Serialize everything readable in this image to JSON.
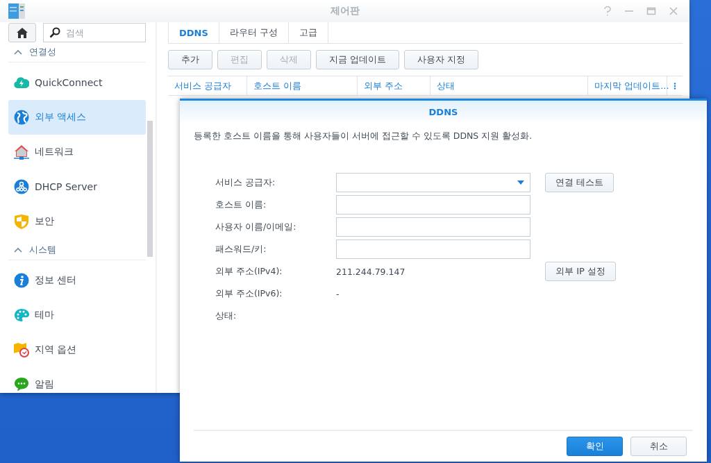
{
  "window": {
    "title": "제어판"
  },
  "search": {
    "placeholder": "검색"
  },
  "sidebar": {
    "sections": [
      {
        "title": "연결성",
        "expanded": true,
        "items": [
          {
            "label": "QuickConnect",
            "kind": "cloud",
            "selected": false
          },
          {
            "label": "외부 액세스",
            "kind": "globe",
            "selected": true
          },
          {
            "label": "네트워크",
            "kind": "house",
            "selected": false
          },
          {
            "label": "DHCP Server",
            "kind": "nodes",
            "selected": false
          },
          {
            "label": "보안",
            "kind": "shield",
            "selected": false
          }
        ]
      },
      {
        "title": "시스템",
        "expanded": true,
        "items": [
          {
            "label": "정보 센터",
            "kind": "info",
            "selected": false
          },
          {
            "label": "테마",
            "kind": "palette",
            "selected": false
          },
          {
            "label": "지역 옵션",
            "kind": "map",
            "selected": false
          },
          {
            "label": "알림",
            "kind": "chat",
            "selected": false
          }
        ]
      }
    ]
  },
  "tabs": [
    {
      "label": "DDNS",
      "selected": true
    },
    {
      "label": "라우터 구성",
      "selected": false
    },
    {
      "label": "고급",
      "selected": false
    }
  ],
  "toolbar": [
    {
      "label": "추가",
      "disabled": false
    },
    {
      "label": "편집",
      "disabled": true
    },
    {
      "label": "삭제",
      "disabled": true
    },
    {
      "label": "지금 업데이트",
      "disabled": false
    },
    {
      "label": "사용자 지정",
      "disabled": false
    }
  ],
  "table": {
    "columns": [
      "서비스 공급자",
      "호스트 이름",
      "외부 주소",
      "상태",
      "마지막 업데이트..."
    ]
  },
  "dialog": {
    "title": "DDNS",
    "description": "등록한 호스트 이름을 통해 사용자들이 서버에 접근할 수 있도록 DDNS 지원 활성화.",
    "rows": [
      {
        "kind": "select",
        "label": "서비스 공급자:",
        "button": "연결 테스트"
      },
      {
        "kind": "input",
        "label": "호스트 이름:"
      },
      {
        "kind": "input",
        "label": "사용자 이름/이메일:"
      },
      {
        "kind": "input",
        "label": "패스워드/키:"
      },
      {
        "kind": "text",
        "label": "외부 주소(IPv4):",
        "value": "211.244.79.147",
        "button": "외부 IP 설정"
      },
      {
        "kind": "text",
        "label": "외부 주소(IPv6):",
        "value": "-"
      },
      {
        "kind": "text",
        "label": "상태:"
      }
    ],
    "buttons": [
      {
        "label": "확인",
        "primary": true
      },
      {
        "label": "취소",
        "primary": false
      }
    ]
  }
}
